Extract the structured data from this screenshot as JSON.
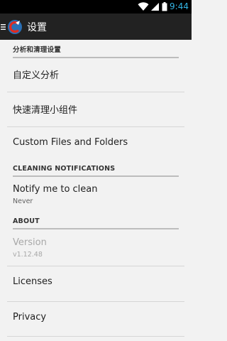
{
  "status_bar": {
    "time": "9:44",
    "icons": [
      "wifi-icon",
      "signal-icon",
      "battery-icon"
    ]
  },
  "action_bar": {
    "title": "设置",
    "icons": [
      "drawer-menu-icon",
      "ccleaner-logo-icon"
    ]
  },
  "sections": [
    {
      "header": "分析和清理设置",
      "items": [
        {
          "title": "自定义分析"
        },
        {
          "title": "快速清理小组件"
        },
        {
          "title": "Custom Files and Folders"
        }
      ]
    },
    {
      "header": "CLEANING NOTIFICATIONS",
      "items": [
        {
          "title": "Notify me to clean",
          "summary": "Never"
        }
      ]
    },
    {
      "header": "ABOUT",
      "items": [
        {
          "title": "Version",
          "summary": "v1.12.48",
          "disabled": true
        },
        {
          "title": "Licenses"
        },
        {
          "title": "Privacy"
        }
      ]
    }
  ],
  "colors": {
    "status_time": "#33b5e5",
    "action_bar_bg": "#222222",
    "page_bg": "#f2f2f2"
  }
}
